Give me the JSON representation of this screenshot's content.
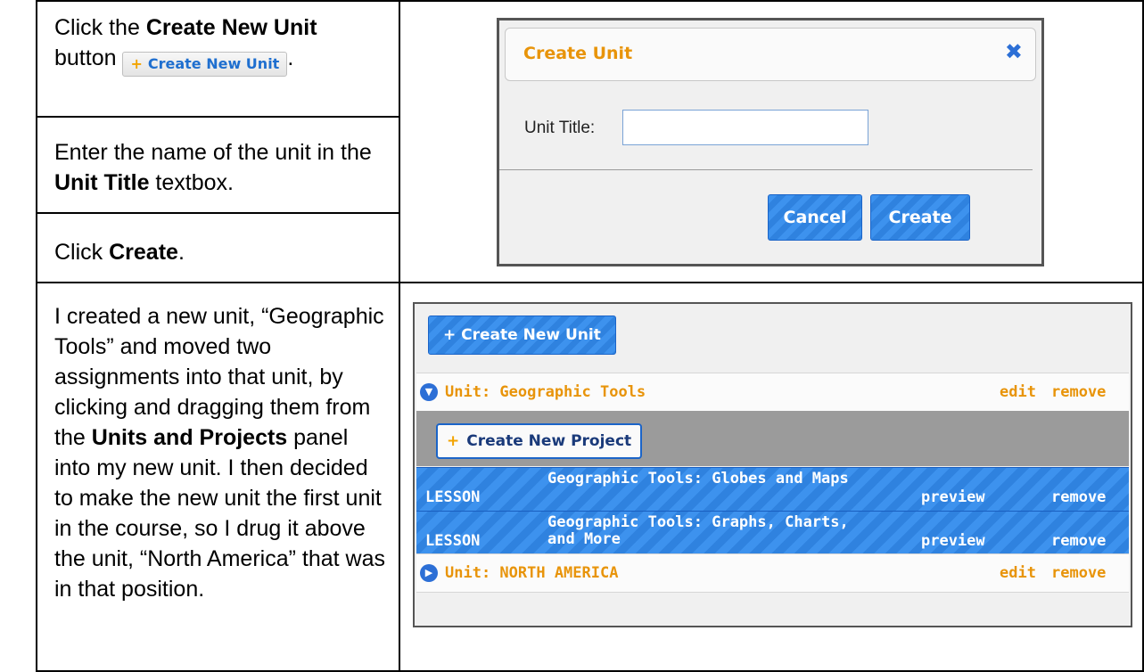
{
  "steps": {
    "step1": {
      "pre": "Click the ",
      "bold": "Create New Unit",
      "mid": "button ",
      "post": "."
    },
    "step1_button": {
      "plus": "+",
      "label": "Create New Unit"
    },
    "step2": {
      "pre": "Enter the name of the unit in the ",
      "bold": "Unit Title",
      "post": " textbox."
    },
    "step3": {
      "pre": "Click ",
      "bold": "Create",
      "post": "."
    },
    "step4": {
      "pre": "I created a new unit, “Geographic Tools” and moved two assignments into that unit, by clicking and dragging them from the ",
      "bold": "Units and Projects",
      "post": " panel into my new unit. I then decided to make the new unit the first unit in the course, so I drug it above the unit, “North America” that was in that position."
    }
  },
  "dialog": {
    "title": "Create Unit",
    "close_icon": "close-icon",
    "field_label": "Unit Title:",
    "field_value": "",
    "cancel_label": "Cancel",
    "create_label": "Create"
  },
  "course_panel": {
    "create_unit_label": "+ Create New Unit",
    "units": [
      {
        "title": "Unit:  Geographic Tools",
        "edit": "edit",
        "remove": "remove",
        "expanded": true
      },
      {
        "title": "Unit:  NORTH AMERICA",
        "edit": "edit",
        "remove": "remove",
        "expanded": false
      }
    ],
    "create_project_plus": "+",
    "create_project_label": "Create New Project",
    "lessons": [
      {
        "type": "LESSON",
        "name": "Geographic Tools: Globes and Maps",
        "preview": "preview",
        "remove": "remove"
      },
      {
        "type": "LESSON",
        "name": "Geographic Tools: Graphs, Charts, and More",
        "preview": "preview",
        "remove": "remove"
      }
    ]
  },
  "colors": {
    "accent_orange": "#e8940a",
    "accent_blue": "#2f82df"
  }
}
